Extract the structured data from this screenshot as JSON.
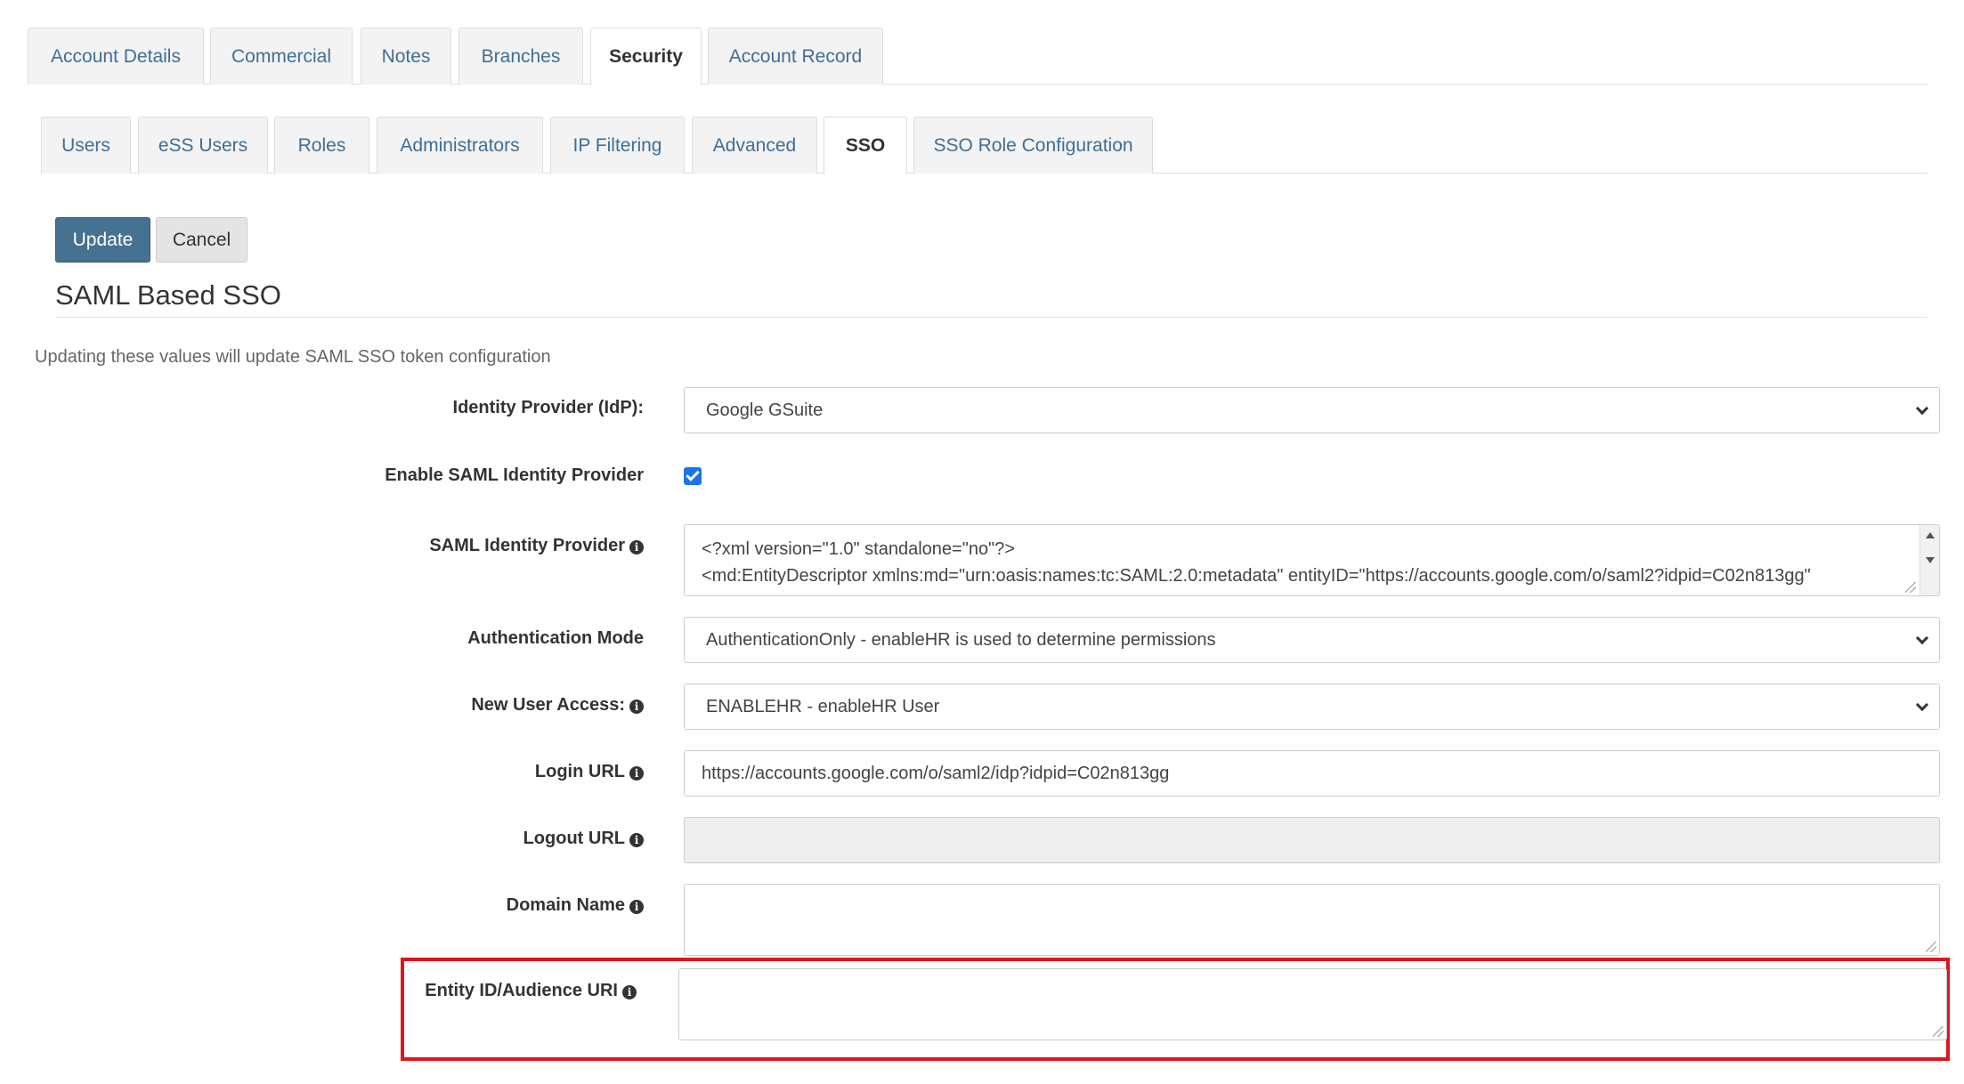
{
  "main_tabs": [
    {
      "label": "Account Details",
      "active": false
    },
    {
      "label": "Commercial",
      "active": false
    },
    {
      "label": "Notes",
      "active": false
    },
    {
      "label": "Branches",
      "active": false
    },
    {
      "label": "Security",
      "active": true
    },
    {
      "label": "Account Record",
      "active": false
    }
  ],
  "security_tabs": [
    {
      "label": "Users",
      "active": false
    },
    {
      "label": "eSS Users",
      "active": false
    },
    {
      "label": "Roles",
      "active": false
    },
    {
      "label": "Administrators",
      "active": false
    },
    {
      "label": "IP Filtering",
      "active": false
    },
    {
      "label": "Advanced",
      "active": false
    },
    {
      "label": "SSO",
      "active": true
    },
    {
      "label": "SSO Role Configuration",
      "active": false
    }
  ],
  "toolbar": {
    "update_label": "Update",
    "cancel_label": "Cancel"
  },
  "section": {
    "title": "SAML Based SSO",
    "help": "Updating these values will update SAML SSO token configuration"
  },
  "form": {
    "idp_label": "Identity Provider (IdP):",
    "idp_value": "Google GSuite",
    "enable_label": "Enable SAML Identity Provider",
    "enable_checked": true,
    "saml_label": "SAML Identity Provider",
    "saml_line1": "<?xml version=\"1.0\" standalone=\"no\"?>",
    "saml_line2": "<md:EntityDescriptor xmlns:md=\"urn:oasis:names:tc:SAML:2.0:metadata\" entityID=\"https://accounts.google.com/o/saml2?idpid=C02n813gg\"",
    "auth_label": "Authentication Mode",
    "auth_value": "AuthenticationOnly - enableHR is used to determine permissions",
    "new_user_label": "New User Access:",
    "new_user_value": "ENABLEHR - enableHR User",
    "login_label": "Login URL",
    "login_value": "https://accounts.google.com/o/saml2/idp?idpid=C02n813gg",
    "logout_label": "Logout URL",
    "logout_value": "",
    "domain_label": "Domain Name",
    "domain_value": "",
    "entity_label": "Entity ID/Audience URI",
    "entity_value": ""
  },
  "colors": {
    "primary": "#457291",
    "link": "#3d6f97",
    "highlight": "#e3131b",
    "checkbox": "#1a73e8"
  }
}
